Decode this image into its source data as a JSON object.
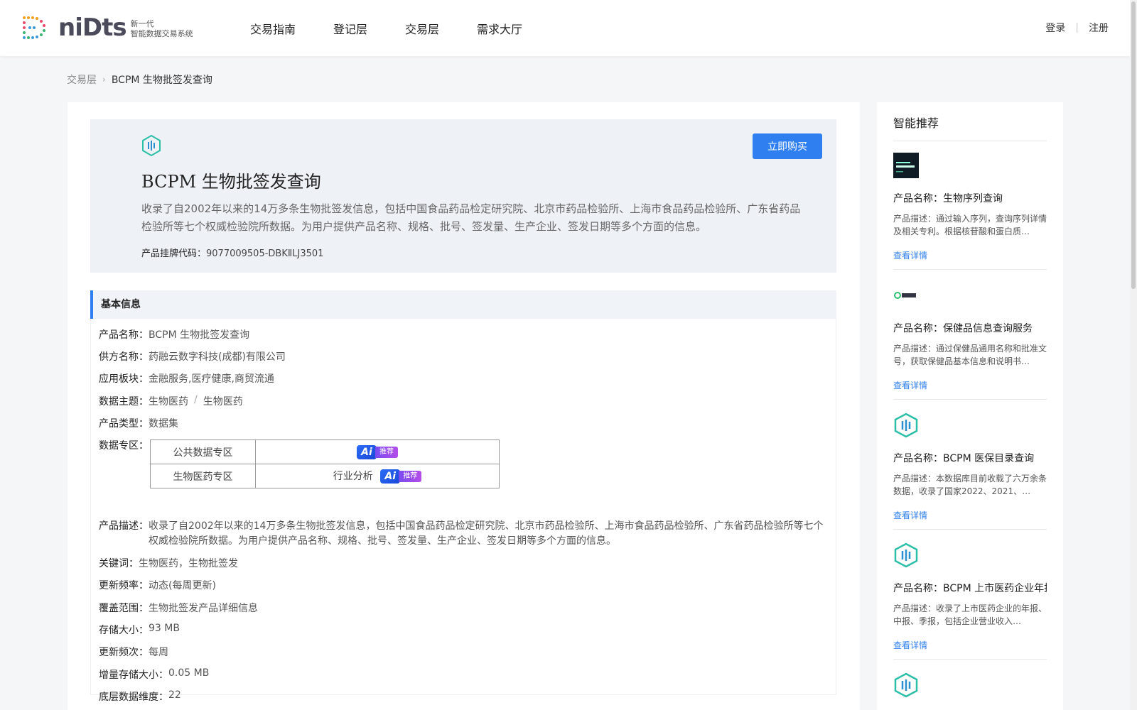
{
  "header": {
    "logo_text": "niDts",
    "logo_sub1": "新一代",
    "logo_sub2": "智能数据交易系统",
    "nav": [
      "交易指南",
      "登记层",
      "交易层",
      "需求大厅"
    ],
    "login": "登录",
    "register": "注册",
    "separator": "|"
  },
  "breadcrumb": {
    "parent": "交易层",
    "current": "BCPM 生物批签发查询"
  },
  "hero": {
    "title": "BCPM 生物批签发查询",
    "description": "收录了自2002年以来的14万多条生物批签发信息，包括中国食品药品检定研究院、北京市药品检验所、上海市食品药品检验所、广东省药品检验所等七个权威检验院所数据。为用户提供产品名称、规格、批号、签发量、生产企业、签发日期等多个方面的信息。",
    "code_label": "产品挂牌代码：",
    "code_value": "9077009505-DBKⅡLJ3501",
    "buy_label": "立即购买"
  },
  "basic_info": {
    "section_title": "基本信息",
    "product_name_label": "产品名称：",
    "product_name": "BCPM 生物批签发查询",
    "supplier_label": "供方名称：",
    "supplier": "药融云数字科技(成都)有限公司",
    "sector_label": "应用板块：",
    "sector": "金融服务,医疗健康,商贸流通",
    "topic_label": "数据主题：",
    "topic_a": "生物医药",
    "topic_sep": "/",
    "topic_b": "生物医药",
    "type_label": "产品类型：",
    "type": "数据集",
    "zone_label": "数据专区：",
    "zones": [
      {
        "name": "公共数据专区",
        "extra": ""
      },
      {
        "name": "生物医药专区",
        "extra": "行业分析"
      }
    ],
    "ai_text": "Ai",
    "ai_tag": "推荐",
    "desc_label": "产品描述：",
    "desc": "收录了自2002年以来的14万多条生物批签发信息，包括中国食品药品检定研究院、北京市药品检验所、上海市食品药品检验所、广东省药品检验所等七个权威检验院所数据。为用户提供产品名称、规格、批号、签发量、生产企业、签发日期等多个方面的信息。",
    "keywords_label": "关键词：",
    "keywords": "生物医药，生物批签发",
    "freq_label": "更新频率：",
    "freq": "动态(每周更新)",
    "coverage_label": "覆盖范围：",
    "coverage": "生物批签发产品详细信息",
    "size_label": "存储大小：",
    "size": "93 MB",
    "period_label": "更新频次：",
    "period": "每周",
    "inc_label": "增量存储大小：",
    "inc": "0.05 MB",
    "dim_label": "底层数据维度：",
    "dim": "22"
  },
  "side": {
    "title": "智能推荐",
    "items": [
      {
        "name": "产品名称：生物序列查询",
        "desc": "产品描述：通过输入序列，查询序列详情及相关专利。根据核苷酸和蛋白质…",
        "link": "查看详情"
      },
      {
        "name": "产品名称：保健品信息查询服务",
        "desc": "产品描述：通过保健品通用名称和批准文号，获取保健品基本信息和说明书…",
        "link": "查看详情"
      },
      {
        "name": "产品名称：BCPM 医保目录查询",
        "desc": "产品描述：本数据库目前收载了六万余条数据，收录了国家2022、2021、…",
        "link": "查看详情"
      },
      {
        "name": "产品名称：BCPM 上市医药企业年报",
        "desc": "产品描述：收录了上市医药企业的年报、中报、季报，包括企业营业收入…",
        "link": "查看详情"
      }
    ]
  },
  "colors": {
    "accent": "#2f7ff0",
    "teal": "#2bbfa8"
  }
}
